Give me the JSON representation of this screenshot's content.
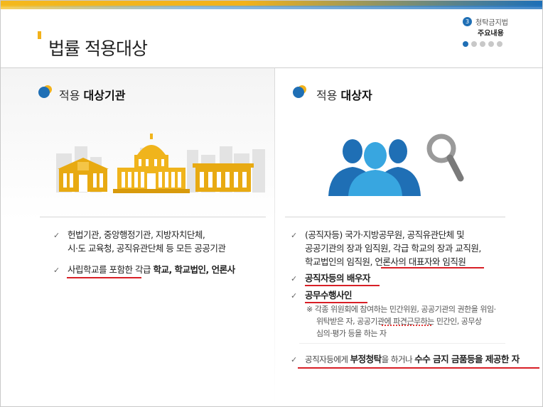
{
  "header": {
    "title": "법률 적용대상",
    "section_number": "3",
    "section_name": "청탁금지법",
    "section_sub": "주요내용",
    "page_dots": 5,
    "active_dot": 0
  },
  "left": {
    "heading_prefix": "적용 ",
    "heading_bold": "대상기관",
    "bullets": [
      {
        "lines": [
          "헌법기관, 중앙행정기관, 지방자치단체,",
          "시·도 교육청, 공직유관단체 등 모든 공공기관"
        ]
      },
      {
        "underlined": "사립학교를 포함한",
        "plain": " 각급 ",
        "bold": "학교, 학교법인, 언론사"
      }
    ]
  },
  "right": {
    "heading_prefix": "적용 ",
    "heading_bold": "대상자",
    "bullet1": {
      "line1": "(공직자등) 국가·지방공무원, 공직유관단체 및",
      "line2": "공공기관의 장과 임직원, 각급 학교의 장과 교직원,",
      "line3_plain": "학교법인의 임직원, ",
      "line3_underlined": "언론사의 대표자와 임직원"
    },
    "bullet2": "공직자등의 배우자",
    "bullet3": "공무수행사인",
    "note_lines": [
      "※ 각종 위원회에 참여하는 민간위원, 공공기관의 권한을 위임·",
      "위탁받은 자, 공공기관에 파견근무하는 민간인, 공무상",
      "심의·평가 등을 하는 자"
    ],
    "bullet4": {
      "part1": "공직자등에게 ",
      "part2": "부정청탁",
      "part3": "을 하거나 ",
      "part4": "수수 금지 금품등을 제공한 자"
    }
  },
  "colors": {
    "accent_blue": "#1f6fb5",
    "accent_yellow": "#f2b21b",
    "underline_red": "#d81f26"
  }
}
